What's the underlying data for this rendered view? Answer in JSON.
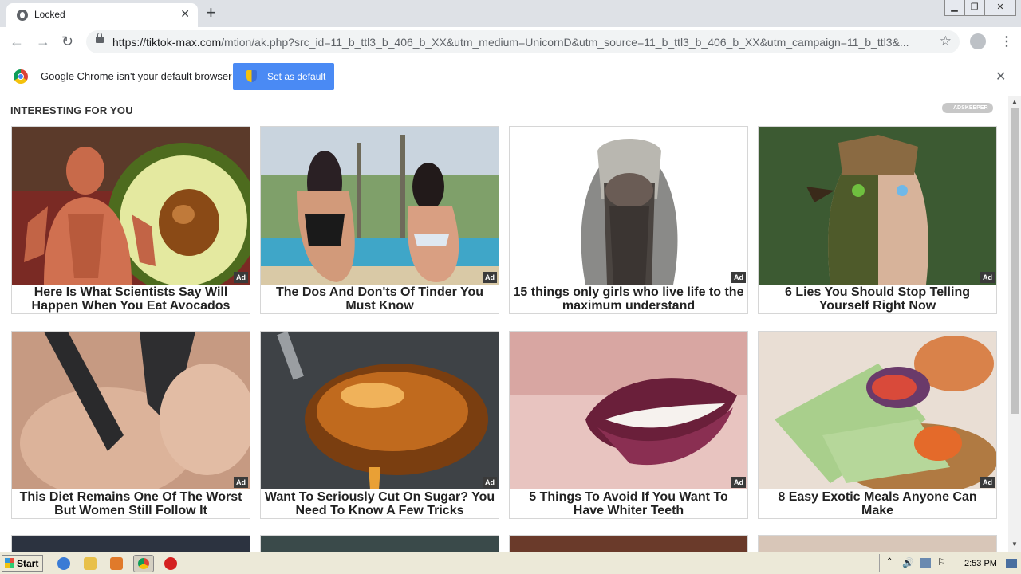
{
  "browser": {
    "tab_title": "Locked",
    "url_host": "https://tiktok-max.com",
    "url_path": "/mtion/ak.php?src_id=11_b_ttl3_b_406_b_XX&utm_medium=UnicornD&utm_source=11_b_ttl3_b_406_b_XX&utm_campaign=11_b_ttl3&..."
  },
  "infobar": {
    "message": "Google Chrome isn't your default browser",
    "button_label": "Set as default"
  },
  "page": {
    "heading": "INTERESTING FOR YOU",
    "brand": "ADSKEEPER",
    "ad_label": "Ad",
    "cards": [
      {
        "caption": "Here Is What Scientists Say Will Happen When You Eat Avocados"
      },
      {
        "caption": "The Dos And Don'ts Of Tinder You Must Know"
      },
      {
        "caption": "15 things only girls who live life to the maximum understand"
      },
      {
        "caption": "6 Lies You Should Stop Telling Yourself Right Now"
      },
      {
        "caption": "This Diet Remains One Of The Worst But Women Still Follow It"
      },
      {
        "caption": "Want To Seriously Cut On Sugar? You Need To Know A Few Tricks"
      },
      {
        "caption": "5 Things To Avoid If You Want To Have Whiter Teeth"
      },
      {
        "caption": "8 Easy Exotic Meals Anyone Can Make"
      }
    ]
  },
  "taskbar": {
    "start_label": "Start",
    "clock": "2:53 PM"
  }
}
